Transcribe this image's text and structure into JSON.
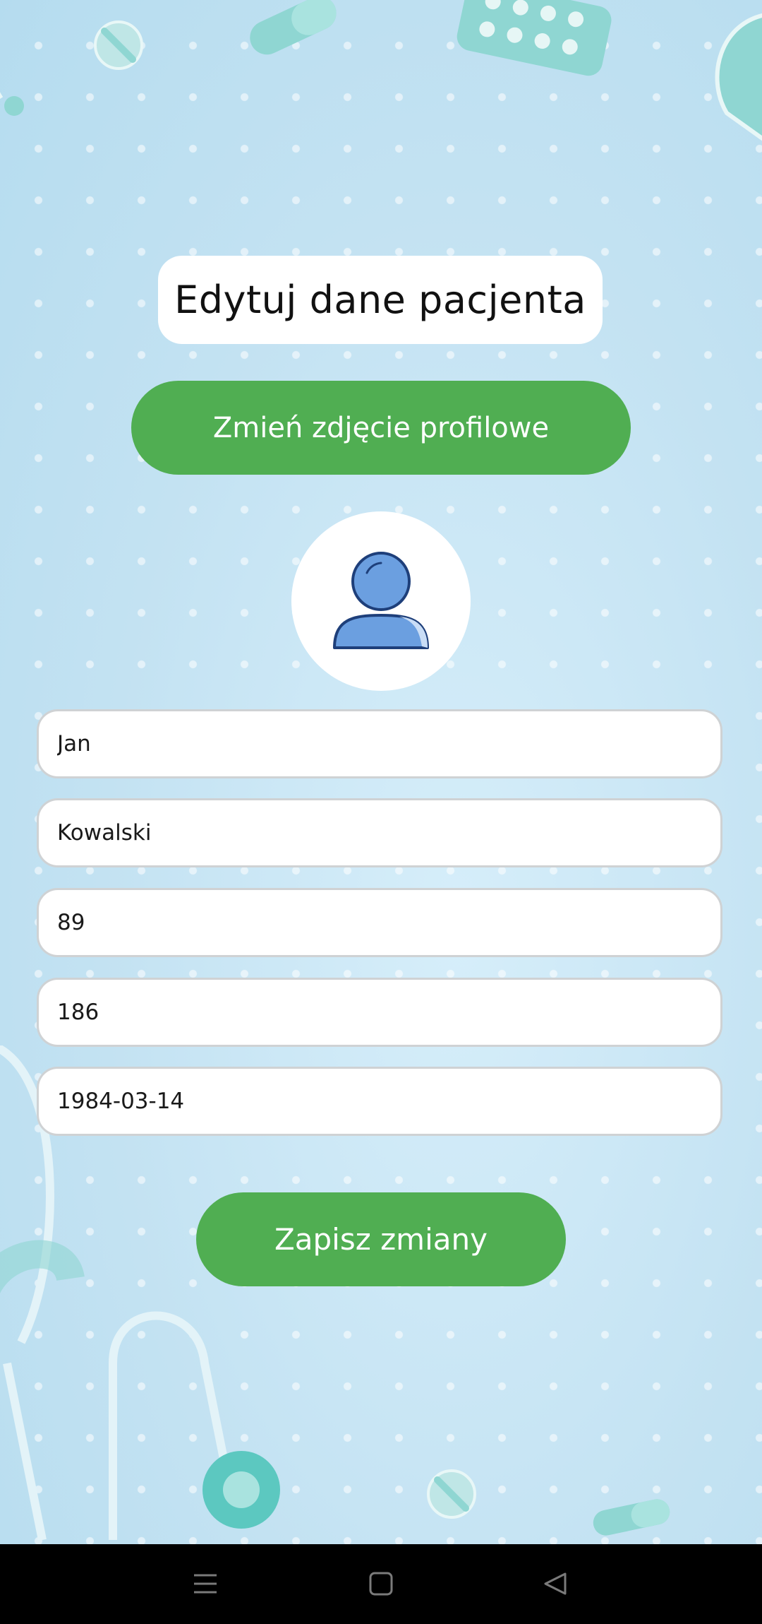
{
  "screen": {
    "title": "Edytuj dane pacjenta",
    "change_photo_label": "Zmień zdjęcie profilowe",
    "save_label": "Zapisz zmiany"
  },
  "fields": {
    "first_name": "Jan",
    "last_name": "Kowalski",
    "weight": "89",
    "height": "186",
    "birth_date": "1984-03-14"
  },
  "icons": {
    "avatar": "user-icon",
    "nav_menu": "menu-icon",
    "nav_home": "home-square-icon",
    "nav_back": "back-triangle-icon"
  },
  "colors": {
    "accent_green": "#50ae52",
    "background": "#c7e4f3",
    "avatar_blue": "#6b9fe0"
  }
}
